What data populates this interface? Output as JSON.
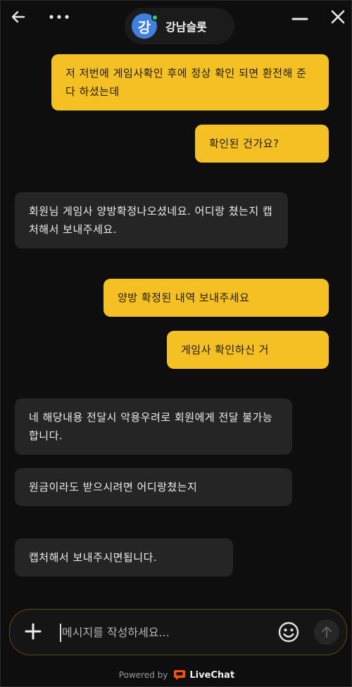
{
  "header": {
    "avatar_letter": "강",
    "title": "강남슬롯"
  },
  "messages": [
    {
      "direction": "out",
      "text": "저 저번에 게임사확인 후에 정상 확인 되면 환전해 준다 하셨는데"
    },
    {
      "direction": "out",
      "text": "확인된 건가요?"
    },
    {
      "direction": "in",
      "text": "회원님 게임사 양방확정나오셨네요. 어디랑 쳤는지 캡처해서 보내주세요."
    },
    {
      "direction": "out",
      "text": "양방 확정된 내역 보내주세요"
    },
    {
      "direction": "out",
      "text": "게임사 확인하신 거"
    },
    {
      "direction": "in",
      "text": "네 해당내용 전달시 악용우려로 회원에게 전달 불가능합니다."
    },
    {
      "direction": "in",
      "text": "원금이라도 받으시려면 어디랑쳤는지"
    },
    {
      "direction": "in",
      "text": "캡처해서 보내주시면됩니다."
    }
  ],
  "composer": {
    "placeholder": "메시지를 작성하세요..."
  },
  "footer": {
    "powered_by": "Powered by",
    "brand": "LiveChat"
  },
  "colors": {
    "outgoing_bubble": "#f5c023",
    "incoming_bubble": "#252525",
    "background": "#0e0e0e"
  },
  "icons": [
    "back-arrow-icon",
    "more-dots-icon",
    "minimize-icon",
    "close-icon",
    "plus-icon",
    "emoji-icon",
    "send-arrow-icon",
    "livechat-logo-icon"
  ]
}
